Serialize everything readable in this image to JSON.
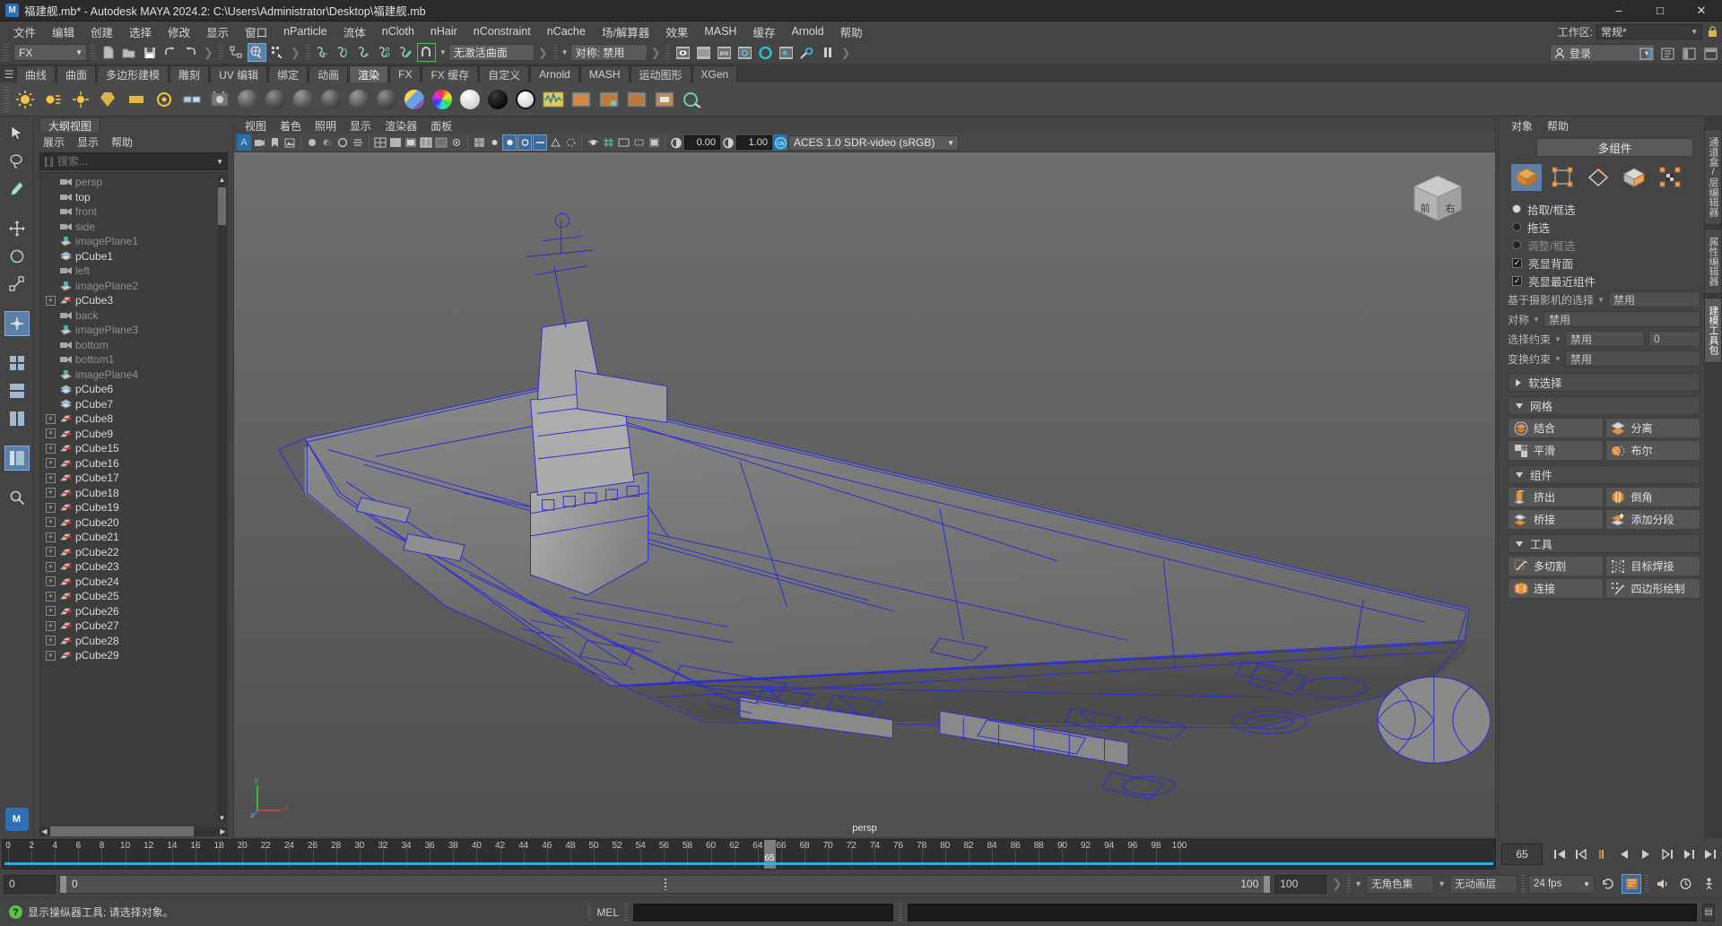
{
  "window": {
    "title": "福建舰.mb* - Autodesk MAYA 2024.2: C:\\Users\\Administrator\\Desktop\\福建舰.mb",
    "logo_text": "M",
    "minimize": "–",
    "maximize": "□",
    "close": "✕"
  },
  "menubar": {
    "items": [
      "文件",
      "编辑",
      "创建",
      "选择",
      "修改",
      "显示",
      "窗口",
      "nParticle",
      "流体",
      "nCloth",
      "nHair",
      "nConstraint",
      "nCache",
      "场/解算器",
      "效果",
      "MASH",
      "缓存",
      "Arnold",
      "帮助"
    ],
    "workspace_label": "工作区:",
    "workspace_value": "常规*",
    "lock_icon": "lock-icon"
  },
  "statusbar": {
    "mode_menu": "FX",
    "surface_field": "无激活曲面",
    "symmetry_field": "对称: 禁用",
    "login_label": "登录"
  },
  "shelf": {
    "tabs": [
      "曲线",
      "曲面",
      "多边形建模",
      "雕刻",
      "UV 编辑",
      "绑定",
      "动画",
      "渲染",
      "FX",
      "FX 缓存",
      "自定义",
      "Arnold",
      "MASH",
      "运动图形",
      "XGen"
    ],
    "active_tab": "渲染"
  },
  "outliner": {
    "tab_label": "大纲视图",
    "menu": [
      "展示",
      "显示",
      "帮助"
    ],
    "search_placeholder": "搜索...",
    "items": [
      {
        "label": "persp",
        "type": "camera",
        "expand": false,
        "dim": true
      },
      {
        "label": "top",
        "type": "camera",
        "expand": false,
        "dim": false
      },
      {
        "label": "front",
        "type": "camera",
        "expand": false,
        "dim": true
      },
      {
        "label": "side",
        "type": "camera",
        "expand": false,
        "dim": true
      },
      {
        "label": "imagePlane1",
        "type": "imageplane",
        "expand": false,
        "dim": true
      },
      {
        "label": "pCube1",
        "type": "mesh",
        "expand": false,
        "dim": false
      },
      {
        "label": "left",
        "type": "camera",
        "expand": false,
        "dim": true
      },
      {
        "label": "imagePlane2",
        "type": "imageplane",
        "expand": false,
        "dim": true
      },
      {
        "label": "pCube3",
        "type": "transform",
        "expand": true,
        "dim": false
      },
      {
        "label": "back",
        "type": "camera",
        "expand": false,
        "dim": true
      },
      {
        "label": "imagePlane3",
        "type": "imageplane",
        "expand": false,
        "dim": true
      },
      {
        "label": "bottom",
        "type": "camera",
        "expand": false,
        "dim": true
      },
      {
        "label": "bottom1",
        "type": "camera",
        "expand": false,
        "dim": true
      },
      {
        "label": "imagePlane4",
        "type": "imageplane",
        "expand": false,
        "dim": true
      },
      {
        "label": "pCube6",
        "type": "mesh",
        "expand": false,
        "dim": false
      },
      {
        "label": "pCube7",
        "type": "mesh",
        "expand": false,
        "dim": false
      },
      {
        "label": "pCube8",
        "type": "transform",
        "expand": true,
        "dim": false
      },
      {
        "label": "pCube9",
        "type": "transform",
        "expand": true,
        "dim": false
      },
      {
        "label": "pCube15",
        "type": "transform",
        "expand": true,
        "dim": false
      },
      {
        "label": "pCube16",
        "type": "transform",
        "expand": true,
        "dim": false
      },
      {
        "label": "pCube17",
        "type": "transform",
        "expand": true,
        "dim": false
      },
      {
        "label": "pCube18",
        "type": "transform",
        "expand": true,
        "dim": false
      },
      {
        "label": "pCube19",
        "type": "transform",
        "expand": true,
        "dim": false
      },
      {
        "label": "pCube20",
        "type": "transform",
        "expand": true,
        "dim": false
      },
      {
        "label": "pCube21",
        "type": "transform",
        "expand": true,
        "dim": false
      },
      {
        "label": "pCube22",
        "type": "transform",
        "expand": true,
        "dim": false
      },
      {
        "label": "pCube23",
        "type": "transform",
        "expand": true,
        "dim": false
      },
      {
        "label": "pCube24",
        "type": "transform",
        "expand": true,
        "dim": false
      },
      {
        "label": "pCube25",
        "type": "transform",
        "expand": true,
        "dim": false
      },
      {
        "label": "pCube26",
        "type": "transform",
        "expand": true,
        "dim": false
      },
      {
        "label": "pCube27",
        "type": "transform",
        "expand": true,
        "dim": false
      },
      {
        "label": "pCube28",
        "type": "transform",
        "expand": true,
        "dim": false
      },
      {
        "label": "pCube29",
        "type": "transform",
        "expand": true,
        "dim": false
      }
    ]
  },
  "viewport": {
    "menu": [
      "视图",
      "着色",
      "照明",
      "显示",
      "渲染器",
      "面板"
    ],
    "exposure": "0.00",
    "gamma": "1.00",
    "colorspace": "ACES 1.0 SDR-video (sRGB)",
    "camera_label": "persp",
    "viewcube_front": "前",
    "viewcube_right": "右",
    "axis_x": "x",
    "axis_y": "y",
    "axis_z": "z"
  },
  "rightpanel": {
    "menu": [
      "对象",
      "帮助"
    ],
    "title": "多组件",
    "component_modes": [
      "object-mode-icon",
      "vertex-mode-icon",
      "edge-mode-icon",
      "face-mode-icon",
      "uv-mode-icon"
    ],
    "selected_mode_index": 0,
    "radios": [
      {
        "label": "拾取/框选",
        "on": true,
        "dim": false
      },
      {
        "label": "拖选",
        "on": false,
        "dim": false
      },
      {
        "label": "调整/框选",
        "on": false,
        "dim": true
      }
    ],
    "checkboxes": [
      {
        "label": "亮显背面",
        "checked": true
      },
      {
        "label": "亮显最近组件",
        "checked": true
      }
    ],
    "options": [
      {
        "label": "基于摄影机的选择",
        "value": "禁用",
        "extra": null
      },
      {
        "label": "对称",
        "value": "禁用",
        "extra": null
      },
      {
        "label": "选择约束",
        "value": "禁用",
        "extra": "0"
      },
      {
        "label": "变换约束",
        "value": "禁用",
        "extra": null
      }
    ],
    "soft_select": "软选择",
    "sections": [
      {
        "title": "网格",
        "buttons": [
          {
            "label": "结合",
            "icon": "combine-icon"
          },
          {
            "label": "分离",
            "icon": "separate-icon"
          },
          {
            "label": "平滑",
            "icon": "smooth-icon"
          },
          {
            "label": "布尔",
            "icon": "boolean-icon"
          }
        ]
      },
      {
        "title": "组件",
        "buttons": [
          {
            "label": "挤出",
            "icon": "extrude-icon"
          },
          {
            "label": "倒角",
            "icon": "bevel-icon"
          },
          {
            "label": "桥接",
            "icon": "bridge-icon"
          },
          {
            "label": "添加分段",
            "icon": "add-divisions-icon"
          }
        ]
      },
      {
        "title": "工具",
        "buttons": [
          {
            "label": "多切割",
            "icon": "multicut-icon"
          },
          {
            "label": "目标焊接",
            "icon": "target-weld-icon"
          },
          {
            "label": "连接",
            "icon": "connect-icon"
          },
          {
            "label": "四边形绘制",
            "icon": "quad-draw-icon"
          }
        ]
      }
    ],
    "vtabs": [
      {
        "label": "通道盒/层编辑器",
        "active": false
      },
      {
        "label": "属性编辑器",
        "active": false
      },
      {
        "label": "建模工具包",
        "active": true
      }
    ]
  },
  "timeline": {
    "ticks": [
      0,
      2,
      4,
      6,
      8,
      10,
      12,
      14,
      16,
      18,
      20,
      22,
      24,
      26,
      28,
      30,
      32,
      34,
      36,
      38,
      40,
      42,
      44,
      46,
      48,
      50,
      52,
      54,
      56,
      58,
      60,
      62,
      64,
      66,
      68,
      70,
      72,
      74,
      76,
      78,
      80,
      82,
      84,
      86,
      88,
      90,
      92,
      94,
      96,
      98,
      100
    ],
    "current_frame": "65",
    "frame_field": "65",
    "playback_buttons": [
      "go-to-start-icon",
      "step-back-key-icon",
      "step-back-frame-icon",
      "play-backwards-icon",
      "play-forwards-icon",
      "step-forward-frame-icon",
      "step-forward-key-icon",
      "go-to-end-icon"
    ]
  },
  "range": {
    "start_outer": "0",
    "start_inner": "0",
    "end_inner": "100",
    "end_outer": "100",
    "character_set": "无角色集",
    "anim_layer": "无动画层",
    "fps": "24 fps"
  },
  "status": {
    "help_text": "显示操纵器工具: 请选择对象。",
    "mel_label": "MEL"
  }
}
